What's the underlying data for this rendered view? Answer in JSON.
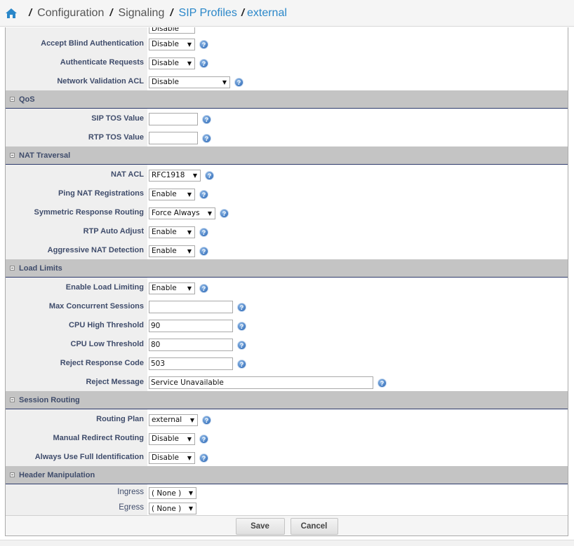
{
  "breadcrumb": {
    "home_icon": "home-icon",
    "items": [
      {
        "label": "Configuration",
        "link": false
      },
      {
        "label": "Signaling",
        "link": false
      },
      {
        "label": "SIP Profiles",
        "link": true
      },
      {
        "label": "external",
        "link": true
      }
    ]
  },
  "partial_top": {
    "value": "Disable"
  },
  "auth": {
    "accept_blind": {
      "label": "Accept Blind Authentication",
      "value": "Disable"
    },
    "authenticate_requests": {
      "label": "Authenticate Requests",
      "value": "Disable"
    },
    "network_validation_acl": {
      "label": "Network Validation ACL",
      "value": "Disable"
    }
  },
  "qos": {
    "title": "QoS",
    "sip_tos": {
      "label": "SIP TOS Value",
      "value": ""
    },
    "rtp_tos": {
      "label": "RTP TOS Value",
      "value": ""
    }
  },
  "nat": {
    "title": "NAT Traversal",
    "nat_acl": {
      "label": "NAT ACL",
      "value": "RFC1918"
    },
    "ping_nat": {
      "label": "Ping NAT Registrations",
      "value": "Enable"
    },
    "symmetric": {
      "label": "Symmetric Response Routing",
      "value": "Force Always"
    },
    "rtp_auto": {
      "label": "RTP Auto Adjust",
      "value": "Enable"
    },
    "aggressive": {
      "label": "Aggressive NAT Detection",
      "value": "Enable"
    }
  },
  "load": {
    "title": "Load Limits",
    "enable": {
      "label": "Enable Load Limiting",
      "value": "Enable"
    },
    "max_sessions": {
      "label": "Max Concurrent Sessions",
      "value": ""
    },
    "cpu_high": {
      "label": "CPU High Threshold",
      "value": "90"
    },
    "cpu_low": {
      "label": "CPU Low Threshold",
      "value": "80"
    },
    "reject_code": {
      "label": "Reject Response Code",
      "value": "503"
    },
    "reject_message": {
      "label": "Reject Message",
      "value": "Service Unavailable"
    }
  },
  "routing": {
    "title": "Session Routing",
    "plan": {
      "label": "Routing Plan",
      "value": "external"
    },
    "manual_redirect": {
      "label": "Manual Redirect Routing",
      "value": "Disable"
    },
    "full_id": {
      "label": "Always Use Full Identification",
      "value": "Disable"
    }
  },
  "header": {
    "title": "Header Manipulation",
    "ingress": {
      "label": "Ingress",
      "value": "( None )"
    },
    "egress": {
      "label": "Egress",
      "value": "( None )"
    }
  },
  "actions": {
    "save": "Save",
    "cancel": "Cancel"
  },
  "glyphs": {
    "arrow": "▼",
    "help": "?"
  },
  "colors": {
    "link": "#2a87c9",
    "label": "#3f4c6b",
    "section_bg": "#c4c4c4",
    "help": "#3f78c0"
  }
}
